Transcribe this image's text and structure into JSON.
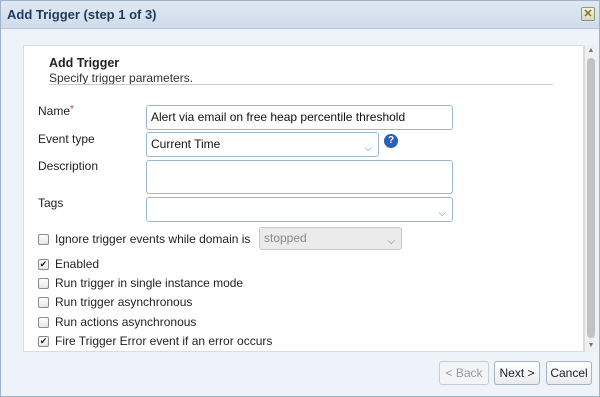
{
  "dialog": {
    "title": "Add Trigger (step 1 of 3)",
    "close_glyph": "✕"
  },
  "section": {
    "heading": "Add Trigger",
    "subheading": "Specify trigger parameters."
  },
  "form": {
    "name": {
      "label": "Name",
      "required_mark": "*",
      "value": "Alert via email on free heap percentile threshold"
    },
    "event_type": {
      "label": "Event type",
      "value": "Current Time",
      "help_glyph": "?"
    },
    "description": {
      "label": "Description",
      "value": ""
    },
    "tags": {
      "label": "Tags",
      "value": ""
    },
    "ignore": {
      "label": "Ignore trigger events while domain is",
      "checked": false,
      "select_value": "stopped"
    },
    "checkboxes": [
      {
        "label": "Enabled",
        "checked": true
      },
      {
        "label": "Run trigger in single instance mode",
        "checked": false
      },
      {
        "label": "Run trigger asynchronous",
        "checked": false
      },
      {
        "label": "Run actions asynchronous",
        "checked": false
      },
      {
        "label": "Fire Trigger Error event if an error occurs",
        "checked": true
      }
    ]
  },
  "footer": {
    "back_label": "< Back",
    "next_label": "Next >",
    "cancel_label": "Cancel"
  },
  "colors": {
    "title_text": "#1f3a5a",
    "field_border": "#9bb8d3",
    "help_icon": "#2a5fb8",
    "required": "#c0392b"
  }
}
